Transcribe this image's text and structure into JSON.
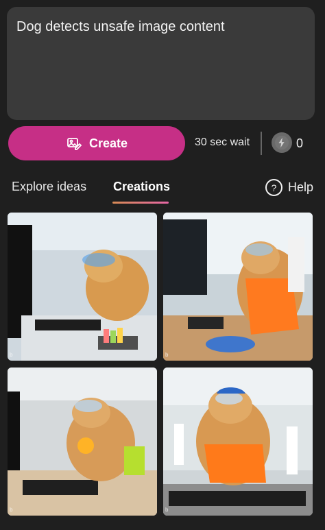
{
  "prompt": {
    "text": "Dog detects unsafe image content"
  },
  "actions": {
    "create_label": "Create",
    "wait_text": "30 sec wait",
    "boost_count": "0"
  },
  "tabs": [
    {
      "label": "Explore ideas",
      "active": false
    },
    {
      "label": "Creations",
      "active": true
    }
  ],
  "help": {
    "label": "Help"
  },
  "images": [
    {
      "subject": "golden retriever in safety goggles at office computer"
    },
    {
      "subject": "golden retriever in goggles and orange vest with scientists"
    },
    {
      "subject": "golden retriever in goggles and headphones at keyboard"
    },
    {
      "subject": "golden retriever in blue cap, goggles, and orange vest at keyboard"
    }
  ],
  "colors": {
    "background": "#1f1f1f",
    "prompt_box": "#3a3a3a",
    "create_button": "#c62f86",
    "tab_underline_start": "#d78a55",
    "tab_underline_end": "#e667a5"
  }
}
